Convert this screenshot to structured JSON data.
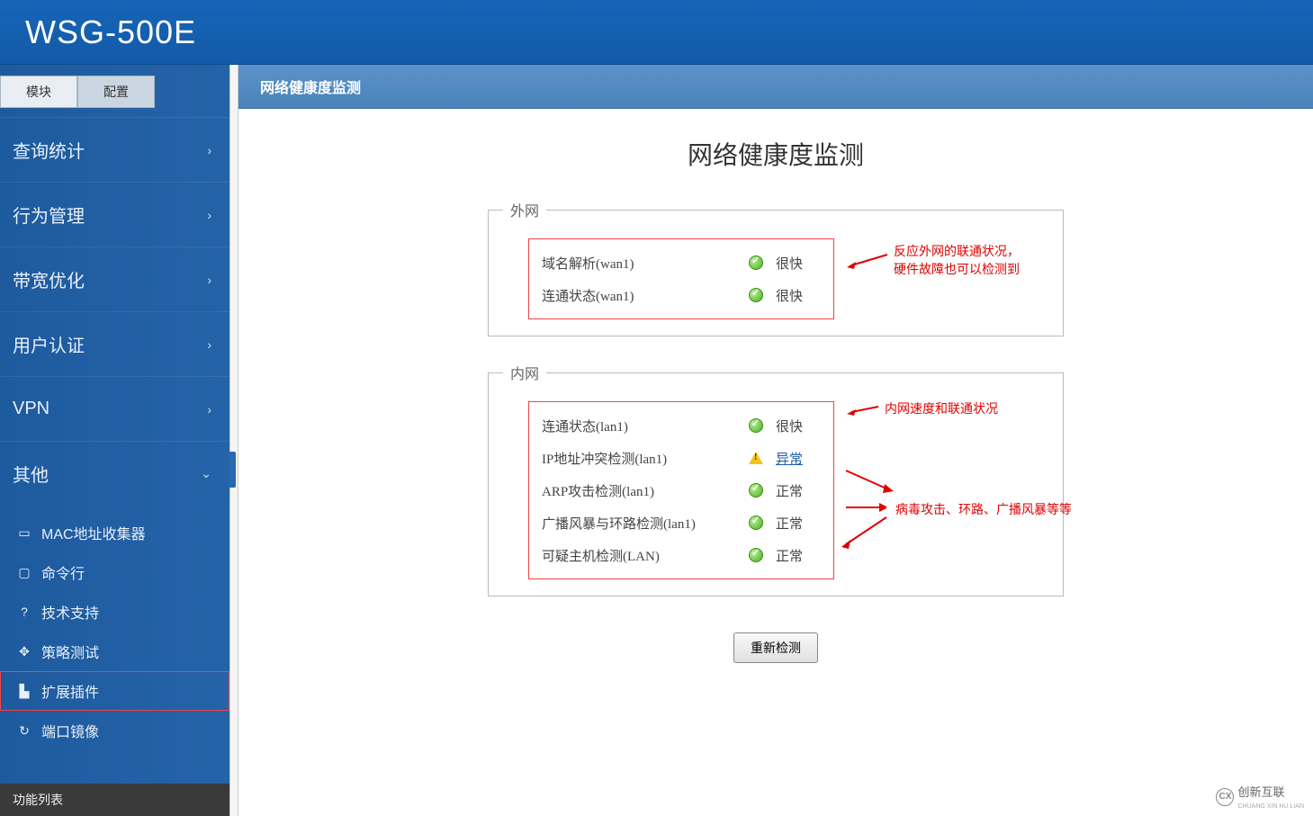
{
  "header": {
    "title": "WSG-500E"
  },
  "sidebar": {
    "tabs": {
      "module": "模块",
      "config": "配置"
    },
    "nav": {
      "query": "查询统计",
      "behavior": "行为管理",
      "bandwidth": "带宽优化",
      "userauth": "用户认证",
      "vpn": "VPN",
      "other": "其他"
    },
    "sub": {
      "mac": "MAC地址收集器",
      "cmd": "命令行",
      "support": "技术支持",
      "policy": "策略测试",
      "plugin": "扩展插件",
      "mirror": "端口镜像"
    },
    "footer": "功能列表"
  },
  "content": {
    "header": "网络健康度监测",
    "title": "网络健康度监测",
    "groups": {
      "wan": {
        "legend": "外网",
        "rows": [
          {
            "label": "域名解析(wan1)",
            "status": "ok",
            "text": "很快"
          },
          {
            "label": "连通状态(wan1)",
            "status": "ok",
            "text": "很快"
          }
        ]
      },
      "lan": {
        "legend": "内网",
        "rows": [
          {
            "label": "连通状态(lan1)",
            "status": "ok",
            "text": "很快"
          },
          {
            "label": "IP地址冲突检测(lan1)",
            "status": "warn",
            "text": "异常",
            "link": true
          },
          {
            "label": "ARP攻击检测(lan1)",
            "status": "ok",
            "text": "正常"
          },
          {
            "label": "广播风暴与环路检测(lan1)",
            "status": "ok",
            "text": "正常"
          },
          {
            "label": "可疑主机检测(LAN)",
            "status": "ok",
            "text": "正常"
          }
        ]
      }
    },
    "button": "重新检测",
    "annotations": {
      "wan1": "反应外网的联通状况，",
      "wan2": "硬件故障也可以检测到",
      "lan1": "内网速度和联通状况",
      "lan2": "病毒攻击、环路、广播风暴等等"
    }
  },
  "watermark": {
    "brand": "创新互联",
    "sub": "CHUANG XIN HU LIAN",
    "logo": "CX"
  }
}
